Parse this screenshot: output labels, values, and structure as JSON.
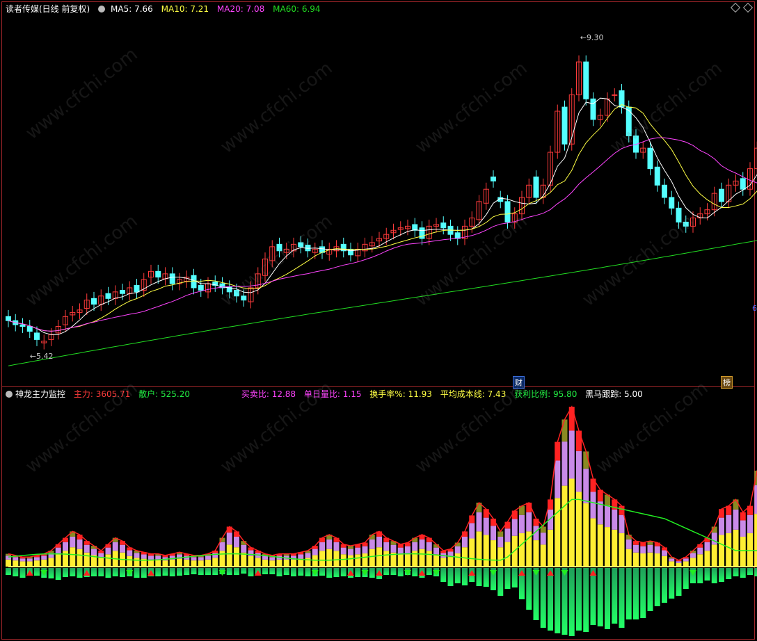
{
  "top_legend": {
    "title": "读者传媒(日线 前复权)",
    "ma5": "MA5: 7.66",
    "ma10": "MA10: 7.21",
    "ma20": "MA20: 7.08",
    "ma60": "MA60: 6.94"
  },
  "bottom_legend": {
    "title": "神龙主力监控",
    "zhuli": "主力: 3605.71",
    "sanhu": "散户: 525.20",
    "maimaibi": "买卖比: 12.88",
    "danriliangbi": "单日量比: 1.15",
    "huanshoulv": "换手率%: 11.93",
    "pingjunchengben": "平均成本线: 7.43",
    "huolibili": "获利比例: 95.80",
    "heima": "黑马跟踪: 5.00"
  },
  "markers": {
    "cai": "财",
    "bang": "榜",
    "edge": "6"
  },
  "watermark": "www.cfchi.com",
  "colors": {
    "up": "#ff3b3b",
    "down": "#54ffff",
    "ma5": "#ffffff",
    "ma10": "#ffff44",
    "ma20": "#ff44ff",
    "ma60": "#22dd22",
    "frame": "#a0262a"
  },
  "chart_data": [
    {
      "type": "candlestick",
      "title": "读者传媒(日线 前复权)",
      "annotations": [
        {
          "label": "9.30",
          "value": 9.3
        },
        {
          "label": "5.42",
          "value": 5.42
        }
      ],
      "ylim": [
        5.2,
        9.5
      ],
      "series_names": [
        "MA5",
        "MA10",
        "MA20",
        "MA60"
      ],
      "close": [
        5.85,
        5.8,
        5.78,
        5.72,
        5.62,
        5.6,
        5.68,
        5.78,
        5.9,
        5.95,
        5.98,
        6.1,
        6.05,
        6.15,
        6.12,
        6.2,
        6.18,
        6.25,
        6.2,
        6.35,
        6.45,
        6.38,
        6.42,
        6.3,
        6.35,
        6.38,
        6.25,
        6.22,
        6.3,
        6.28,
        6.25,
        6.2,
        6.15,
        6.1,
        6.25,
        6.42,
        6.6,
        6.75,
        6.7,
        6.72,
        6.78,
        6.75,
        6.7,
        6.72,
        6.68,
        6.72,
        6.75,
        6.7,
        6.65,
        6.72,
        6.78,
        6.8,
        6.85,
        6.9,
        6.95,
        6.98,
        7.0,
        6.95,
        6.85,
        7.0,
        7.02,
        6.98,
        6.9,
        6.85,
        7.0,
        7.1,
        7.3,
        7.45,
        7.55,
        7.3,
        7.05,
        7.15,
        7.35,
        7.5,
        7.35,
        7.5,
        7.9,
        8.4,
        8.0,
        8.6,
        9.0,
        8.55,
        8.3,
        8.35,
        8.55,
        8.6,
        8.45,
        8.1,
        7.9,
        7.95,
        7.7,
        7.5,
        7.35,
        7.22,
        7.05,
        7.0,
        7.1,
        7.15,
        7.2,
        7.4,
        7.3,
        7.5,
        7.55,
        7.45,
        7.7,
        7.95,
        8.35
      ],
      "open": [
        5.9,
        5.85,
        5.8,
        5.78,
        5.7,
        5.58,
        5.62,
        5.7,
        5.8,
        5.92,
        5.95,
        6.0,
        6.12,
        6.05,
        6.18,
        6.12,
        6.22,
        6.18,
        6.28,
        6.22,
        6.38,
        6.45,
        6.36,
        6.42,
        6.3,
        6.33,
        6.4,
        6.28,
        6.2,
        6.32,
        6.3,
        6.26,
        6.22,
        6.15,
        6.08,
        6.25,
        6.4,
        6.58,
        6.78,
        6.68,
        6.7,
        6.8,
        6.77,
        6.68,
        6.75,
        6.66,
        6.7,
        6.78,
        6.72,
        6.64,
        6.7,
        6.76,
        6.82,
        6.85,
        6.92,
        6.96,
        6.97,
        7.02,
        6.98,
        6.85,
        7.0,
        7.04,
        7.0,
        6.92,
        6.85,
        7.0,
        7.08,
        7.28,
        7.6,
        7.35,
        7.3,
        7.05,
        7.15,
        7.35,
        7.6,
        7.35,
        7.5,
        7.9,
        8.45,
        8.0,
        8.6,
        9.0,
        8.55,
        8.3,
        8.35,
        8.6,
        8.65,
        8.45,
        8.1,
        7.9,
        7.95,
        7.72,
        7.5,
        7.35,
        7.22,
        7.05,
        7.0,
        7.1,
        7.15,
        7.2,
        7.45,
        7.3,
        7.5,
        7.58,
        7.45,
        7.7,
        7.95
      ]
    },
    {
      "type": "bar",
      "title": "神龙主力监控",
      "series_names": [
        "主力",
        "散户",
        "平均成本线"
      ],
      "main_force": [
        0.08,
        0.07,
        0.06,
        0.06,
        0.07,
        0.08,
        0.1,
        0.14,
        0.18,
        0.22,
        0.2,
        0.16,
        0.13,
        0.1,
        0.14,
        0.18,
        0.16,
        0.12,
        0.1,
        0.09,
        0.08,
        0.08,
        0.07,
        0.08,
        0.09,
        0.08,
        0.07,
        0.07,
        0.08,
        0.1,
        0.18,
        0.25,
        0.22,
        0.16,
        0.12,
        0.1,
        0.08,
        0.07,
        0.08,
        0.08,
        0.08,
        0.09,
        0.1,
        0.13,
        0.18,
        0.2,
        0.18,
        0.14,
        0.13,
        0.14,
        0.15,
        0.2,
        0.22,
        0.18,
        0.16,
        0.14,
        0.15,
        0.18,
        0.2,
        0.18,
        0.14,
        0.1,
        0.11,
        0.15,
        0.22,
        0.32,
        0.4,
        0.36,
        0.3,
        0.22,
        0.28,
        0.35,
        0.38,
        0.4,
        0.3,
        0.25,
        0.42,
        0.78,
        0.92,
        1.0,
        0.85,
        0.72,
        0.55,
        0.48,
        0.45,
        0.42,
        0.38,
        0.2,
        0.16,
        0.15,
        0.16,
        0.15,
        0.12,
        0.06,
        0.04,
        0.06,
        0.1,
        0.14,
        0.18,
        0.25,
        0.36,
        0.38,
        0.42,
        0.34,
        0.38,
        0.6,
        0.72
      ],
      "retail": [
        -0.1,
        -0.12,
        -0.14,
        -0.1,
        -0.11,
        -0.14,
        -0.15,
        -0.17,
        -0.13,
        -0.12,
        -0.14,
        -0.13,
        -0.12,
        -0.12,
        -0.14,
        -0.12,
        -0.13,
        -0.12,
        -0.14,
        -0.14,
        -0.12,
        -0.12,
        -0.11,
        -0.12,
        -0.11,
        -0.1,
        -0.09,
        -0.1,
        -0.1,
        -0.1,
        -0.09,
        -0.1,
        -0.1,
        -0.08,
        -0.12,
        -0.1,
        -0.09,
        -0.09,
        -0.12,
        -0.1,
        -0.12,
        -0.11,
        -0.12,
        -0.12,
        -0.11,
        -0.14,
        -0.13,
        -0.12,
        -0.14,
        -0.13,
        -0.13,
        -0.14,
        -0.16,
        -0.1,
        -0.1,
        -0.12,
        -0.1,
        -0.12,
        -0.14,
        -0.1,
        -0.12,
        -0.2,
        -0.26,
        -0.22,
        -0.25,
        -0.2,
        -0.26,
        -0.27,
        -0.32,
        -0.4,
        -0.3,
        -0.28,
        -0.45,
        -0.6,
        -0.75,
        -0.86,
        -0.9,
        -0.94,
        -0.96,
        -0.98,
        -0.9,
        -0.92,
        -0.82,
        -0.84,
        -0.88,
        -0.8,
        -0.86,
        -0.74,
        -0.74,
        -0.72,
        -0.62,
        -0.55,
        -0.5,
        -0.44,
        -0.4,
        -0.3,
        -0.22,
        -0.22,
        -0.18,
        -0.22,
        -0.2,
        -0.16,
        -0.12,
        -0.14,
        -0.1,
        -0.12
      ]
    }
  ]
}
